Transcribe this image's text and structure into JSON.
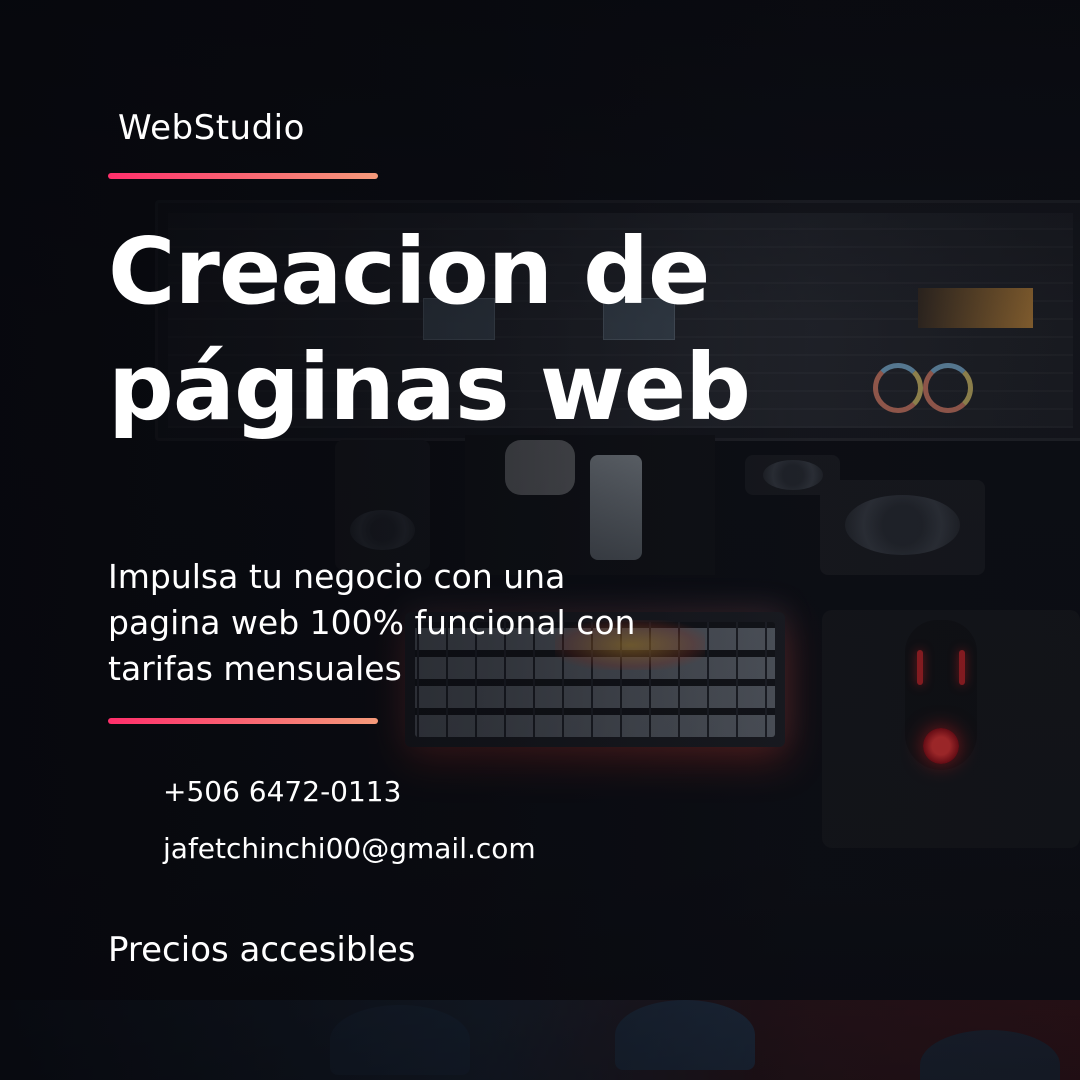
{
  "brand": {
    "name": "WebStudio"
  },
  "headline": {
    "line1": "Creacion de",
    "line2": "páginas web"
  },
  "tagline": {
    "line1": "Impulsa tu negocio con una",
    "line2": "pagina web 100% funcional con",
    "line3": "tarifas mensuales"
  },
  "contact": {
    "phone": "+506 6472-0113",
    "email": "jafetchinchi00@gmail.com"
  },
  "footer": {
    "note": "Precios accesibles"
  },
  "colors": {
    "accent_start": "#ff2f6b",
    "accent_end": "#f59a7a",
    "text": "#ffffff",
    "background": "#101219"
  },
  "background_image": {
    "subject": "desk-setup-photo"
  }
}
